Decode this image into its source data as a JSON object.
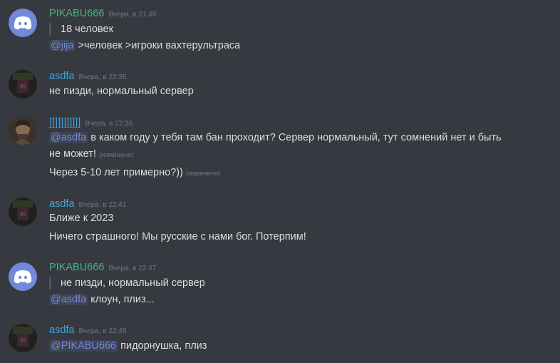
{
  "messages": [
    {
      "username": "PIKABU666",
      "timestamp": "Вчера, в 21:48",
      "quote": "18 человек",
      "lines": [
        {
          "mention": "@jija",
          "text": ">человек >игроки вахтерультраса"
        }
      ]
    },
    {
      "username": "asdfa",
      "timestamp": "Вчера, в 22:35",
      "lines": [
        {
          "text": "не пизди, нормальный сервер"
        }
      ]
    },
    {
      "username": "]]]]]]]]]]]",
      "timestamp": "Вчера, в 22:36",
      "lines": [
        {
          "mention": "@asdfa",
          "text": "в каком году у тебя там бан проходит? Сервер нормальный, тут сомнений нет и быть"
        },
        {
          "text": "не может!",
          "edited": "(изменено)"
        },
        {
          "text": "Через 5-10 лет примерно?))",
          "edited": "(изменено)"
        }
      ]
    },
    {
      "username": "asdfa",
      "timestamp": "Вчера, в 22:41",
      "lines": [
        {
          "text": "Ближе к 2023"
        },
        {
          "text": "Ничего страшного! Мы русские с нами бог. Потерпим!"
        }
      ]
    },
    {
      "username": "PIKABU666",
      "timestamp": "Вчера, в 22:47",
      "quote": "не пизди, нормальный сервер",
      "lines": [
        {
          "mention": "@asdfa",
          "text": "клоун, плиз..."
        }
      ]
    },
    {
      "username": "asdfa",
      "timestamp": "Вчера, в 22:49",
      "lines": [
        {
          "mention": "@PIKABU666",
          "text": "пидорнушка, плиз"
        }
      ]
    }
  ],
  "colors": {
    "background": "#36393f",
    "username_green": "#43b581",
    "username_blue": "#3ea6e0",
    "mention": "#7289da",
    "timestamp": "#72767d"
  }
}
